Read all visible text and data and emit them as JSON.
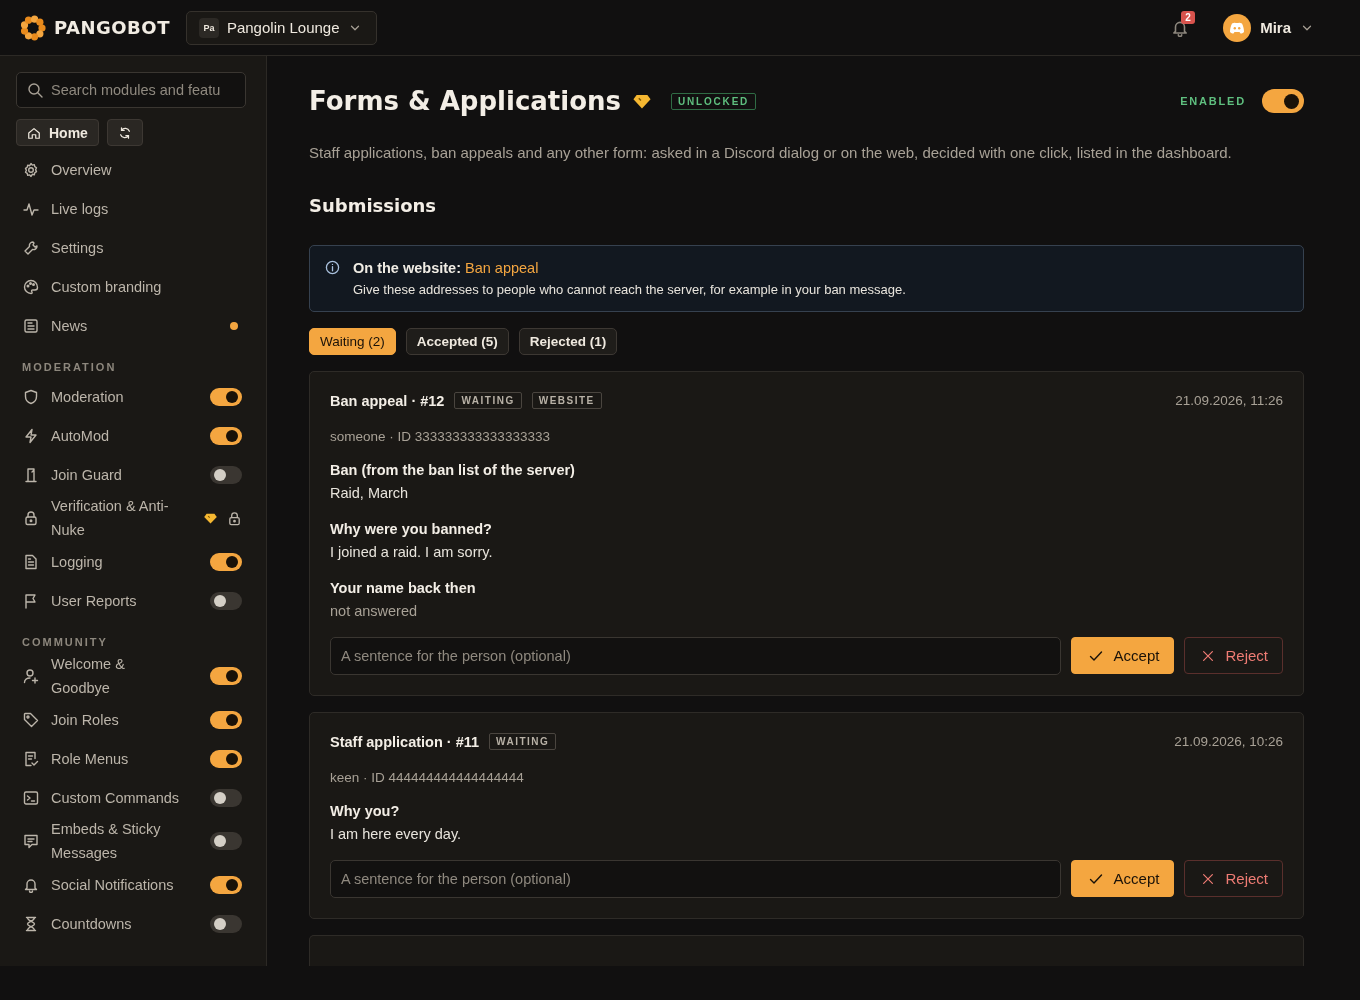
{
  "header": {
    "brand": "PANGOBOT",
    "server": {
      "initials": "Pa",
      "name": "Pangolin Lounge"
    },
    "notifications": {
      "count": "2"
    },
    "user": {
      "name": "Mira"
    }
  },
  "sidebar": {
    "search": {
      "placeholder": "Search modules and featu"
    },
    "home": "Home",
    "links": [
      {
        "label": "Overview",
        "unread": false
      },
      {
        "label": "Live logs",
        "unread": false
      },
      {
        "label": "Settings",
        "unread": false
      },
      {
        "label": "Custom branding",
        "unread": false
      },
      {
        "label": "News",
        "unread": true
      }
    ],
    "sections": [
      {
        "title": "MODERATION",
        "items": [
          {
            "label": "Moderation",
            "kind": "toggle",
            "on": true
          },
          {
            "label": "AutoMod",
            "kind": "toggle",
            "on": true
          },
          {
            "label": "Join Guard",
            "kind": "toggle",
            "on": false
          },
          {
            "label": "Verification & Anti-Nuke",
            "kind": "locked"
          },
          {
            "label": "Logging",
            "kind": "toggle",
            "on": true
          },
          {
            "label": "User Reports",
            "kind": "toggle",
            "on": false
          }
        ]
      },
      {
        "title": "COMMUNITY",
        "items": [
          {
            "label": "Welcome & Goodbye",
            "kind": "toggle",
            "on": true
          },
          {
            "label": "Join Roles",
            "kind": "toggle",
            "on": true
          },
          {
            "label": "Role Menus",
            "kind": "toggle",
            "on": true
          },
          {
            "label": "Custom Commands",
            "kind": "toggle",
            "on": false
          },
          {
            "label": "Embeds & Sticky Messages",
            "kind": "toggle",
            "on": false
          },
          {
            "label": "Social Notifications",
            "kind": "toggle",
            "on": true
          },
          {
            "label": "Countdowns",
            "kind": "toggle",
            "on": false
          }
        ]
      }
    ]
  },
  "page": {
    "title": "Forms & Applications",
    "badge": "UNLOCKED",
    "enabled_label": "ENABLED",
    "enabled": true,
    "description": "Staff applications, ban appeals and any other form: asked in a Discord dialog or on the web, decided with one click, listed in the dashboard.",
    "section_title": "Submissions",
    "info": {
      "title": "On the website:",
      "link": "Ban appeal",
      "text": "Give these addresses to people who cannot reach the server, for example in your ban message."
    },
    "tabs": [
      {
        "label": "Waiting (2)",
        "selected": true
      },
      {
        "label": "Accepted (5)",
        "selected": false
      },
      {
        "label": "Rejected (1)",
        "selected": false
      }
    ],
    "submissions": [
      {
        "title": "Ban appeal · #12",
        "tags": [
          "WAITING",
          "WEBSITE"
        ],
        "date": "21.09.2026, 11:26",
        "author": "someone · ID 333333333333333333",
        "answers": [
          {
            "question": "Ban (from the ban list of the server)",
            "answer": "Raid, March",
            "answered": true
          },
          {
            "question": "Why were you banned?",
            "answer": "I joined a raid. I am sorry.",
            "answered": true
          },
          {
            "question": "Your name back then",
            "answer": "not answered",
            "answered": false
          }
        ],
        "placeholder": "A sentence for the person (optional)",
        "accept": "Accept",
        "reject": "Reject"
      },
      {
        "title": "Staff application · #11",
        "tags": [
          "WAITING"
        ],
        "date": "21.09.2026, 10:26",
        "author": "keen · ID 444444444444444444",
        "answers": [
          {
            "question": "Why you?",
            "answer": "I am here every day.",
            "answered": true
          }
        ],
        "placeholder": "A sentence for the person (optional)",
        "accept": "Accept",
        "reject": "Reject"
      }
    ]
  }
}
